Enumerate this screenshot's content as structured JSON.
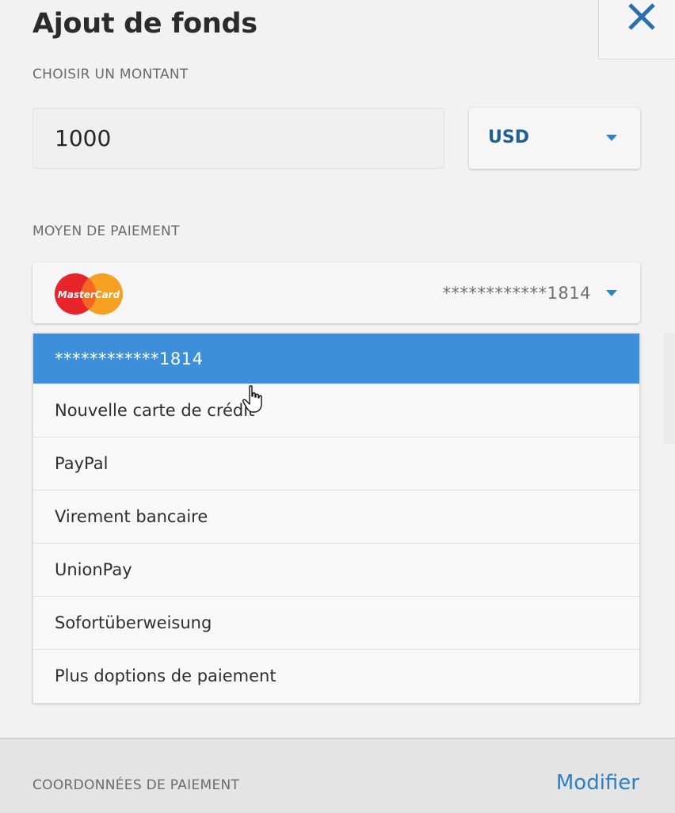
{
  "header": {
    "title": "Ajout de fonds",
    "close_icon": "close-icon"
  },
  "amount_section": {
    "label": "CHOISIR UN MONTANT",
    "amount_value": "1000",
    "currency": "USD"
  },
  "payment_section": {
    "label": "MOYEN DE PAIEMENT",
    "selected_card_icon": "mastercard-icon",
    "selected_card_logo_text": "MasterCard",
    "selected_card": "************1814",
    "options": [
      {
        "label": "************1814",
        "selected": true
      },
      {
        "label": "Nouvelle carte de crédit",
        "selected": false
      },
      {
        "label": "PayPal",
        "selected": false
      },
      {
        "label": "Virement bancaire",
        "selected": false
      },
      {
        "label": "UnionPay",
        "selected": false
      },
      {
        "label": "Sofortüberweisung",
        "selected": false
      },
      {
        "label": "Plus doptions de paiement",
        "selected": false
      }
    ]
  },
  "footer": {
    "label": "COORDONNÉES DE PAIEMENT",
    "modify_link": "Modifier"
  },
  "colors": {
    "accent_blue": "#3d8fd9",
    "link_blue": "#2f7fc1",
    "close_blue": "#2b6fb0",
    "currency_blue": "#1f5f93"
  }
}
